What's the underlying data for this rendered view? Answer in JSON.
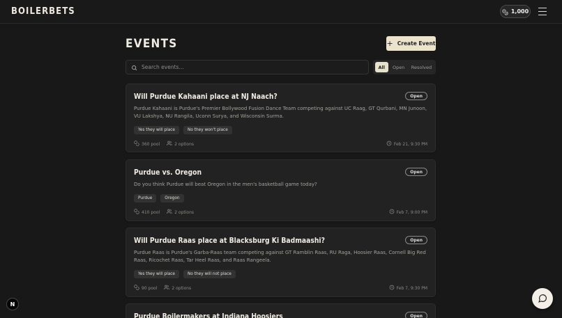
{
  "header": {
    "brand": "BOILERBETS",
    "balance": "1,000"
  },
  "page": {
    "title": "EVENTS",
    "create_label": "Create Event"
  },
  "search": {
    "placeholder": "Search events..."
  },
  "filters": [
    "All",
    "Open",
    "Resolved"
  ],
  "events": [
    {
      "title": "Will Purdue Kahaani place at NJ Naach?",
      "status": "Open",
      "description": "Purdue Kahaani is Purdue's Premier Bollywood Fusion Dance Team competing against UC Raag, GT Qurbani, MN Junoon, VU Lakshya, NU Rangila, Uconn Surya, and Wisconsin Surma.",
      "options": [
        "Yes they will place",
        "No they won't place"
      ],
      "pool": "360 pool",
      "options_count": "2 options",
      "date": "Feb 21, 9:30 PM"
    },
    {
      "title": "Purdue vs. Oregon",
      "status": "Open",
      "description": "Do you think Purdue will beat Oregon in the men's basketball game today?",
      "options": [
        "Purdue",
        "Oregon"
      ],
      "pool": "410 pool",
      "options_count": "2 options",
      "date": "Feb 7, 9:00 PM"
    },
    {
      "title": "Will Purdue Raas place at Blacksburg Ki Badmaashi?",
      "status": "Open",
      "description": "Purdue Raas is Purdue's Garba-Raas team competing against GT Ramblin Raas, RU Raga, Hoosier Raas, Cornell Big Red Raas, Ricochet Raas, Tar Heel Raas, and Raas Rangeela.",
      "options": [
        "Yes they will place",
        "No they will not place"
      ],
      "pool": "90 pool",
      "options_count": "2 options",
      "date": "Feb 7, 9:30 PM"
    },
    {
      "title": "Purdue Boilermakers at Indiana Hoosiers",
      "status": "Open"
    }
  ],
  "icons": {
    "coins": "coins-icon",
    "menu": "hamburger-menu-icon",
    "plus": "plus-icon",
    "search": "search-icon",
    "users": "users-icon",
    "clock": "clock-icon",
    "chat": "chat-bubble-icon",
    "next": "nextjs-logo-icon"
  },
  "colors": {
    "background": "#181818",
    "card": "#222222",
    "accent": "#ebe3cc"
  }
}
